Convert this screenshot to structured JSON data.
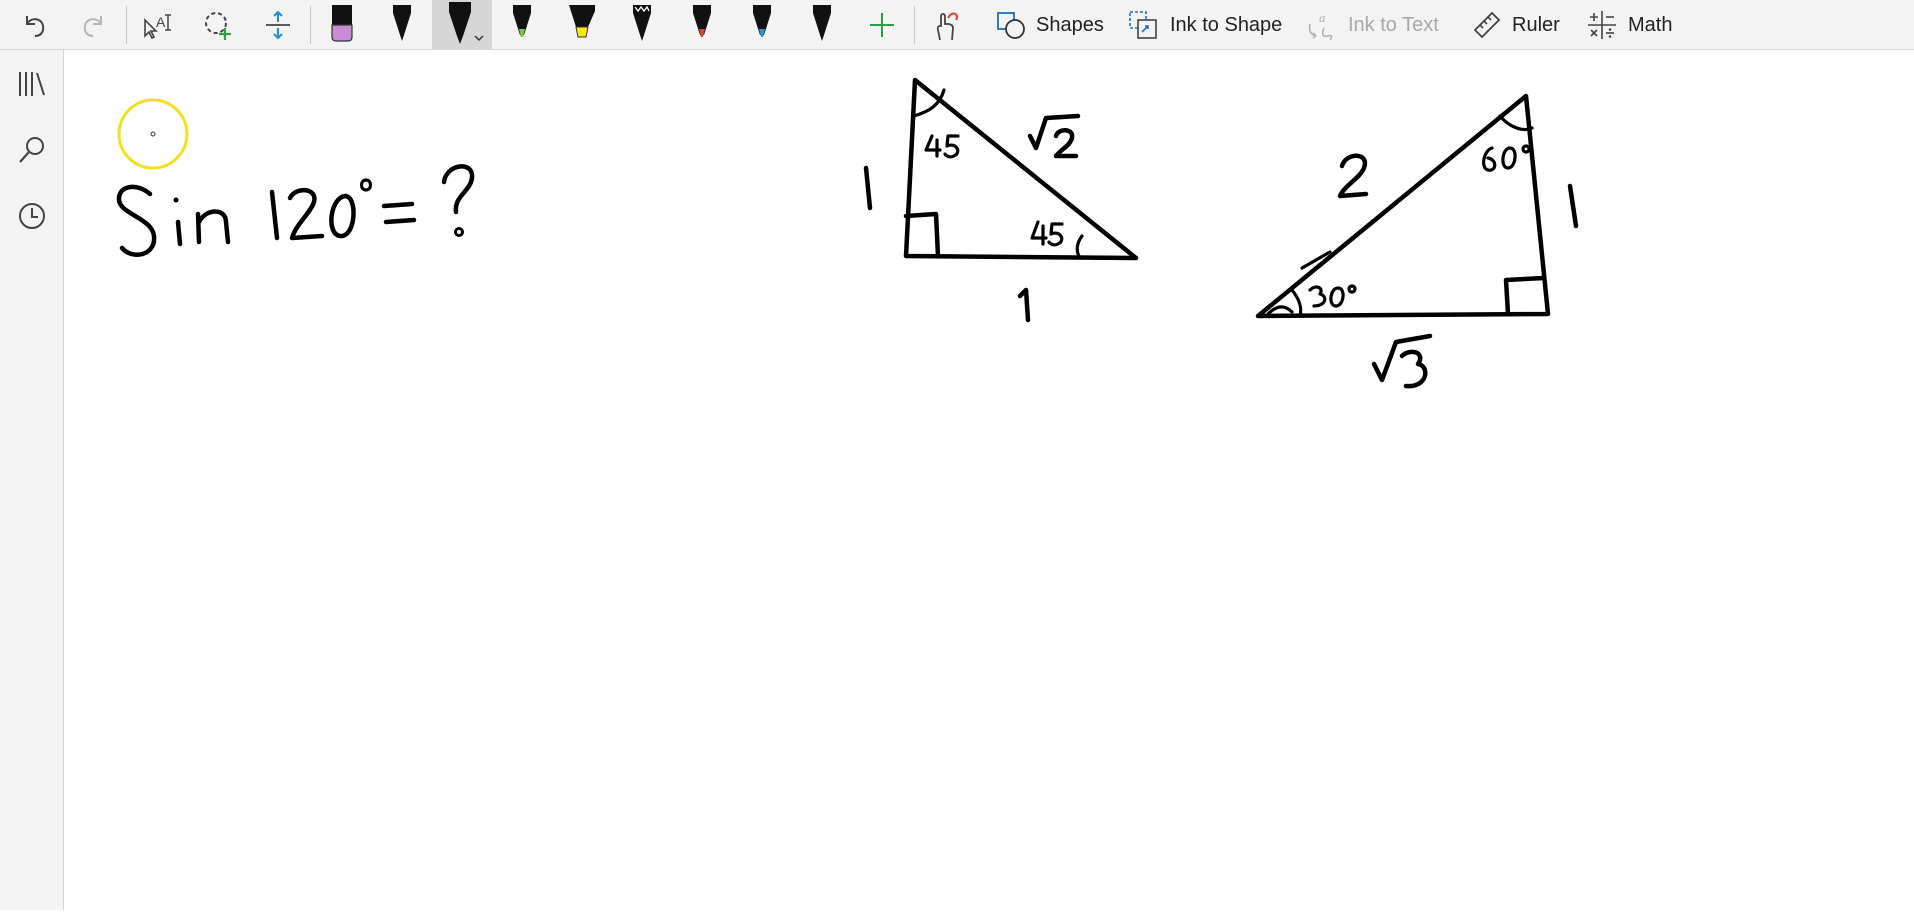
{
  "toolbar": {
    "shapes_label": "Shapes",
    "ink_to_shape_label": "Ink to Shape",
    "ink_to_text_label": "Ink to Text",
    "ruler_label": "Ruler",
    "math_label": "Math",
    "icons": [
      "undo-icon",
      "redo-icon",
      "ink-select-icon",
      "lasso-select-icon",
      "insert-space-icon",
      "eraser-icon",
      "pen-icon",
      "highlighter-icon",
      "add-pen-icon",
      "touch-drawing-icon",
      "shapes-icon",
      "ink-to-shape-icon",
      "ink-to-text-icon",
      "ruler-icon",
      "math-icon"
    ],
    "pens": [
      {
        "name": "eraser",
        "color": "#c98bd6"
      },
      {
        "name": "pen-black-1",
        "color": "#000000"
      },
      {
        "name": "pen-black-selected",
        "color": "#000000"
      },
      {
        "name": "pen-green",
        "color": "#7ec242"
      },
      {
        "name": "highlighter-yellow",
        "color": "#ffea00"
      },
      {
        "name": "pen-galaxy",
        "color": "#000000"
      },
      {
        "name": "pen-red",
        "color": "#d9462b"
      },
      {
        "name": "pen-teal",
        "color": "#1e9bc1"
      },
      {
        "name": "pen-black-2",
        "color": "#000000"
      }
    ],
    "add_pen_color": "#2f9e44"
  },
  "sidebar": {
    "icons": [
      "notebooks-icon",
      "search-icon",
      "recent-icon"
    ]
  },
  "canvas": {
    "cursor_ring_color": "#f0e020"
  }
}
